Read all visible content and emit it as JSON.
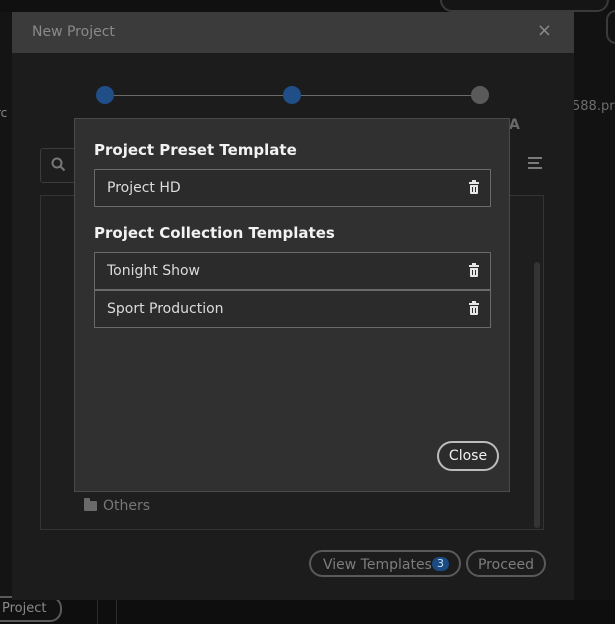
{
  "background": {
    "left_fragment_top": "",
    "left_fragment_mid": "rc",
    "right_fragment": "588.prp",
    "bottom_project_button": "Project"
  },
  "new_project_dialog": {
    "title": "New Project",
    "close_glyph": "×",
    "step_fragment": "A",
    "folder_others_label": "Others",
    "view_templates_label": "View Templates",
    "view_templates_count": "3",
    "proceed_label": "Proceed"
  },
  "templates_modal": {
    "preset_heading": "Project Preset Template",
    "preset_items": [
      {
        "label": "Project HD"
      }
    ],
    "collection_heading": "Project Collection Templates",
    "collection_items": [
      {
        "label": "Tonight Show"
      },
      {
        "label": "Sport Production"
      }
    ],
    "close_label": "Close"
  },
  "colors": {
    "accent": "#1f4f86",
    "modal_bg": "#303030",
    "page_bg": "#0b0b0b"
  },
  "icons": [
    "search-icon",
    "list-view-icon",
    "folder-icon",
    "trash-icon",
    "close-icon"
  ]
}
